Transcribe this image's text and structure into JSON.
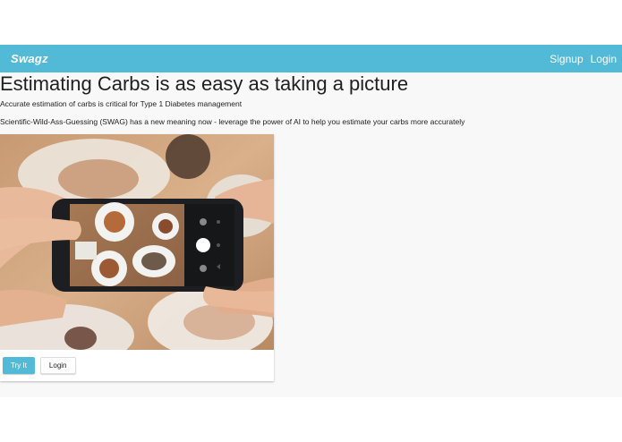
{
  "navbar": {
    "brand": "Swagz",
    "links": [
      "Signup",
      "Login"
    ],
    "color": "#52bad6"
  },
  "hero": {
    "title": "Estimating Carbs is as easy as taking a picture",
    "subtitle1": "Accurate estimation of carbs is critical for Type 1 Diabetes management",
    "subtitle2": "Scientific-Wild-Ass-Guessing (SWAG) has a new meaning now - leverage the power of AI to help you estimate your carbs more accurately"
  },
  "card": {
    "image": "hands-holding-phone-photographing-food",
    "actions": {
      "try_label": "Try It",
      "login_label": "Login"
    }
  }
}
